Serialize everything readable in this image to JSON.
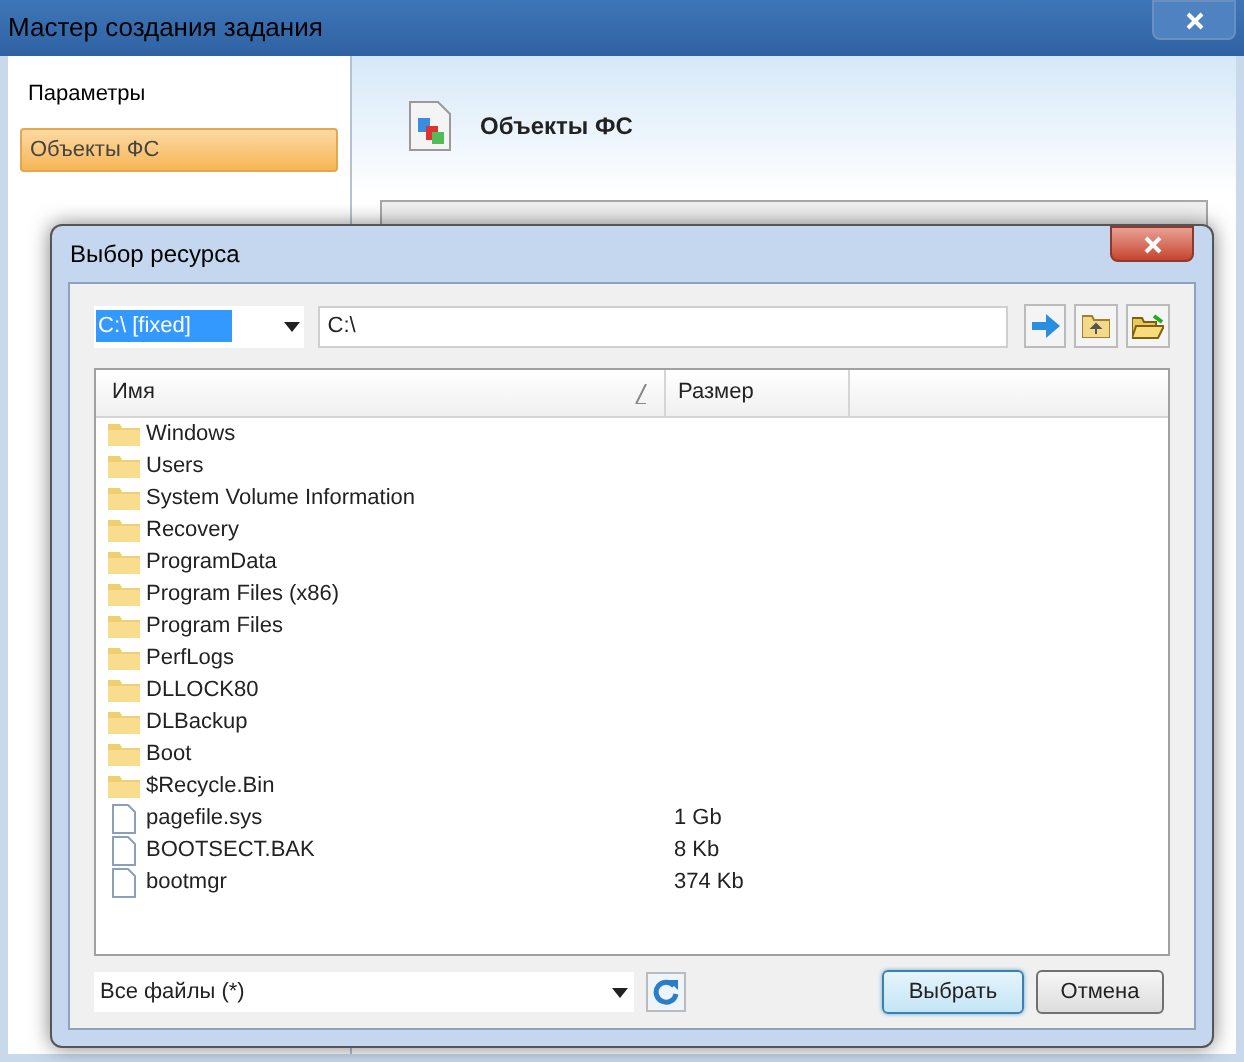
{
  "window": {
    "title": "Мастер создания задания"
  },
  "sidebar": {
    "items": [
      {
        "label": "Параметры",
        "selected": false
      },
      {
        "label": "Объекты ФС",
        "selected": true
      }
    ]
  },
  "page_header": {
    "title": "Объекты ФС"
  },
  "dialog": {
    "title": "Выбор ресурса",
    "drive": {
      "value": "C:\\ [fixed]"
    },
    "path": {
      "value": "C:\\"
    },
    "columns": [
      "Имя",
      "Размер"
    ],
    "files": [
      {
        "name": "Windows",
        "kind": "folder"
      },
      {
        "name": "Users",
        "kind": "folder"
      },
      {
        "name": "System Volume Information",
        "kind": "folder"
      },
      {
        "name": "Recovery",
        "kind": "folder"
      },
      {
        "name": "ProgramData",
        "kind": "folder"
      },
      {
        "name": "Program Files (x86)",
        "kind": "folder"
      },
      {
        "name": "Program Files",
        "kind": "folder"
      },
      {
        "name": "PerfLogs",
        "kind": "folder"
      },
      {
        "name": "DLLOCK80",
        "kind": "folder"
      },
      {
        "name": "DLBackup",
        "kind": "folder"
      },
      {
        "name": "Boot",
        "kind": "folder"
      },
      {
        "name": "$Recycle.Bin",
        "kind": "folder"
      },
      {
        "name": "pagefile.sys",
        "kind": "file",
        "size": "1 Gb"
      },
      {
        "name": "BOOTSECT.BAK",
        "kind": "file",
        "size": "8 Kb"
      },
      {
        "name": "bootmgr",
        "kind": "file",
        "size": "374 Kb"
      }
    ],
    "filter": {
      "value": "Все файлы (*)"
    },
    "buttons": [
      {
        "label": "Выбрать",
        "default": true
      },
      {
        "label": "Отмена",
        "default": false
      }
    ]
  }
}
